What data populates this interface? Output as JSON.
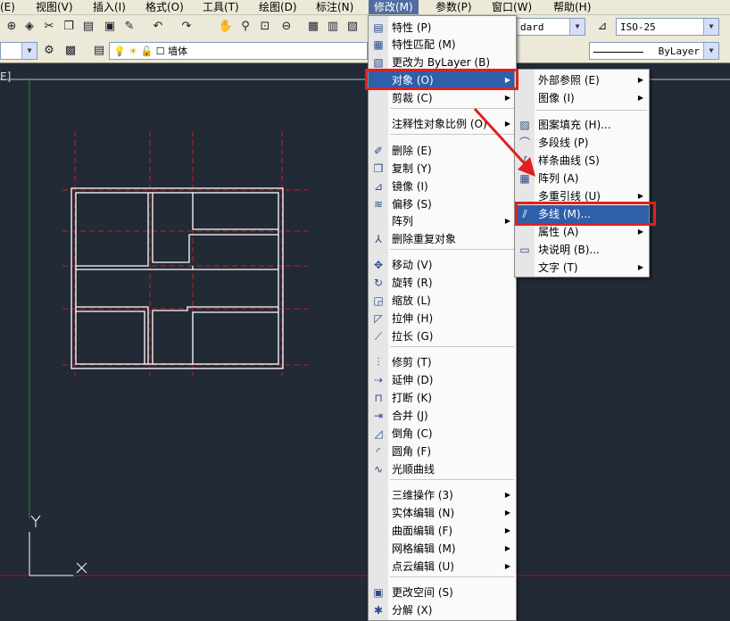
{
  "menubar": {
    "items": [
      "(E)",
      "视图(V)",
      "插入(I)",
      "格式(O)",
      "工具(T)",
      "绘图(D)",
      "标注(N)",
      "修改(M)",
      "参数(P)",
      "窗口(W)",
      "帮助(H)"
    ],
    "active": "修改(M)"
  },
  "toolbar": {
    "textstyle_combo": "dard",
    "dimstyle_combo": "ISO-25",
    "layer_name": "墙体",
    "linetype_combo": "ByLayer",
    "viewport_label": "E]"
  },
  "modify_menu": {
    "items": [
      {
        "label": "特性 (P)",
        "icon": "properties-icon",
        "submenu": false
      },
      {
        "label": "特性匹配 (M)",
        "icon": "match-properties-icon",
        "submenu": false
      },
      {
        "label": "更改为 ByLayer (B)",
        "icon": "bylayer-icon",
        "submenu": false
      },
      {
        "label": "对象 (O)",
        "icon": "",
        "submenu": true,
        "highlighted": true
      },
      {
        "label": "剪裁 (C)",
        "icon": "",
        "submenu": true
      },
      {
        "label": "注释性对象比例 (O)",
        "icon": "",
        "submenu": true
      },
      {
        "label": "删除 (E)",
        "icon": "eraser-icon",
        "submenu": false
      },
      {
        "label": "复制 (Y)",
        "icon": "copy-icon",
        "submenu": false
      },
      {
        "label": "镜像 (I)",
        "icon": "mirror-icon",
        "submenu": false
      },
      {
        "label": "偏移 (S)",
        "icon": "offset-icon",
        "submenu": false
      },
      {
        "label": "阵列",
        "icon": "",
        "submenu": true
      },
      {
        "label": "删除重复对象",
        "icon": "delete-duplicates-icon",
        "submenu": false
      },
      {
        "label": "移动 (V)",
        "icon": "move-icon",
        "submenu": false
      },
      {
        "label": "旋转 (R)",
        "icon": "rotate-icon",
        "submenu": false
      },
      {
        "label": "缩放 (L)",
        "icon": "scale-icon",
        "submenu": false
      },
      {
        "label": "拉伸 (H)",
        "icon": "stretch-icon",
        "submenu": false
      },
      {
        "label": "拉长 (G)",
        "icon": "lengthen-icon",
        "submenu": false
      },
      {
        "label": "修剪 (T)",
        "icon": "trim-icon",
        "submenu": false
      },
      {
        "label": "延伸 (D)",
        "icon": "extend-icon",
        "submenu": false
      },
      {
        "label": "打断 (K)",
        "icon": "break-icon",
        "submenu": false
      },
      {
        "label": "合并 (J)",
        "icon": "join-icon",
        "submenu": false
      },
      {
        "label": "倒角 (C)",
        "icon": "chamfer-icon",
        "submenu": false
      },
      {
        "label": "圆角 (F)",
        "icon": "fillet-icon",
        "submenu": false
      },
      {
        "label": "光顺曲线",
        "icon": "blend-curves-icon",
        "submenu": false
      },
      {
        "label": "三维操作 (3)",
        "icon": "",
        "submenu": true
      },
      {
        "label": "实体编辑 (N)",
        "icon": "",
        "submenu": true
      },
      {
        "label": "曲面编辑 (F)",
        "icon": "",
        "submenu": true
      },
      {
        "label": "网格编辑 (M)",
        "icon": "",
        "submenu": true
      },
      {
        "label": "点云编辑 (U)",
        "icon": "",
        "submenu": true
      },
      {
        "label": "更改空间 (S)",
        "icon": "change-space-icon",
        "submenu": false
      },
      {
        "label": "分解 (X)",
        "icon": "explode-icon",
        "submenu": false
      }
    ]
  },
  "object_submenu": {
    "items": [
      {
        "label": "外部参照 (E)",
        "icon": "",
        "submenu": true
      },
      {
        "label": "图像 (I)",
        "icon": "",
        "submenu": true
      },
      {
        "label": "图案填充 (H)...",
        "icon": "hatch-icon",
        "submenu": false
      },
      {
        "label": "多段线 (P)",
        "icon": "polyline-icon",
        "submenu": false
      },
      {
        "label": "样条曲线 (S)",
        "icon": "spline-icon",
        "submenu": false
      },
      {
        "label": "阵列 (A)",
        "icon": "array-icon",
        "submenu": false
      },
      {
        "label": "多重引线 (U)",
        "icon": "",
        "submenu": true
      },
      {
        "label": "多线 (M)...",
        "icon": "multiline-icon",
        "submenu": false,
        "highlighted": true
      },
      {
        "label": "属性 (A)",
        "icon": "",
        "submenu": true
      },
      {
        "label": "块说明 (B)...",
        "icon": "block-description-icon",
        "submenu": false
      },
      {
        "label": "文字 (T)",
        "icon": "",
        "submenu": true
      }
    ]
  },
  "colors": {
    "canvas": "#222a36",
    "menu_bg": "#fafafa",
    "highlight": "#2f5fa8",
    "annotation_red": "#e02020",
    "wall_line": "#ffffff",
    "guide_line": "#c81e1e"
  }
}
